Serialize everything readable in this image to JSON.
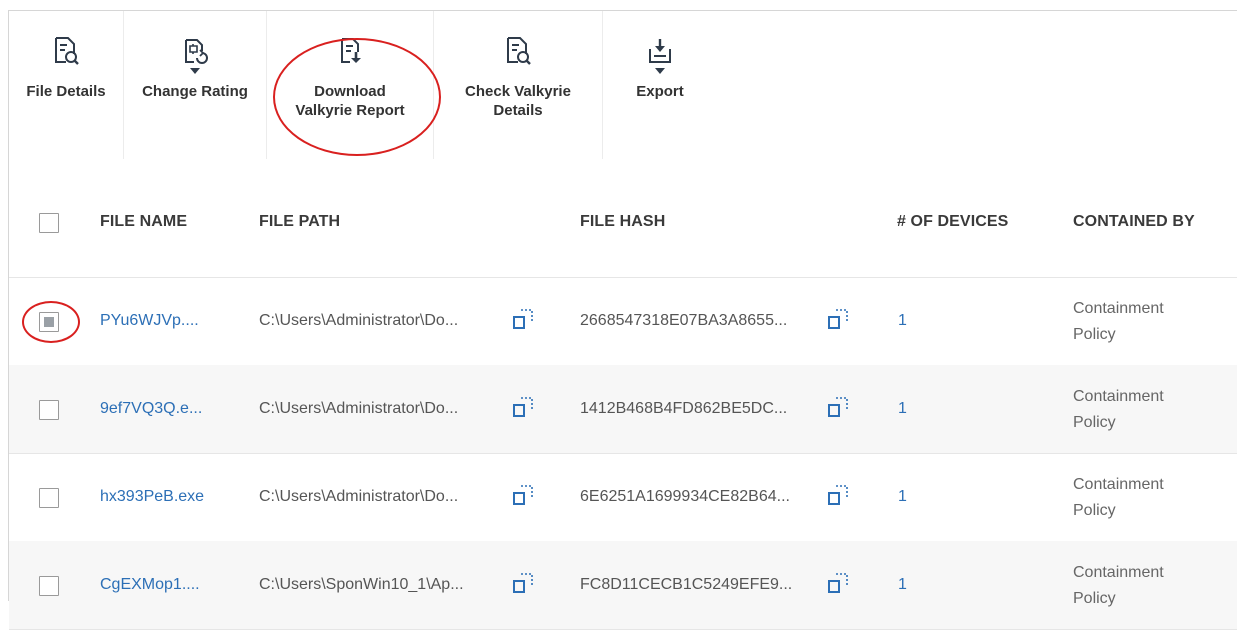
{
  "toolbar": {
    "buttons": [
      {
        "label": "File Details",
        "icon": "file-details-icon",
        "dropdown": false
      },
      {
        "label": "Change Rating",
        "icon": "change-rating-icon",
        "dropdown": true
      },
      {
        "label": "Download\nValkyrie Report",
        "icon": "download-report-icon",
        "dropdown": false
      },
      {
        "label": "Check Valkyrie\nDetails",
        "icon": "check-details-icon",
        "dropdown": false
      },
      {
        "label": "Export",
        "icon": "export-icon",
        "dropdown": true
      }
    ]
  },
  "table": {
    "headers": {
      "file_name": "FILE NAME",
      "file_path": "FILE PATH",
      "file_hash": "FILE HASH",
      "devices": "# OF DEVICES",
      "contained_by": "CONTAINED BY"
    },
    "rows": [
      {
        "checked": true,
        "file_name": "PYu6WJVp....",
        "file_path": "C:\\Users\\Administrator\\Do...",
        "file_hash": "2668547318E07BA3A8655...",
        "devices": "1",
        "contained_by": "Containment Policy"
      },
      {
        "checked": false,
        "file_name": "9ef7VQ3Q.e...",
        "file_path": "C:\\Users\\Administrator\\Do...",
        "file_hash": "1412B468B4FD862BE5DC...",
        "devices": "1",
        "contained_by": "Containment Policy"
      },
      {
        "checked": false,
        "file_name": "hx393PeB.exe",
        "file_path": "C:\\Users\\Administrator\\Do...",
        "file_hash": "6E6251A1699934CE82B64...",
        "devices": "1",
        "contained_by": "Containment Policy"
      },
      {
        "checked": false,
        "file_name": "CgEXMop1....",
        "file_path": "C:\\Users\\SponWin10_1\\Ap...",
        "file_hash": "FC8D11CECB1C5249EFE9...",
        "devices": "1",
        "contained_by": "Containment Policy"
      }
    ]
  },
  "colors": {
    "link": "#2c6fb6",
    "highlight": "#d9201f",
    "icon": "#2f3b4a"
  }
}
